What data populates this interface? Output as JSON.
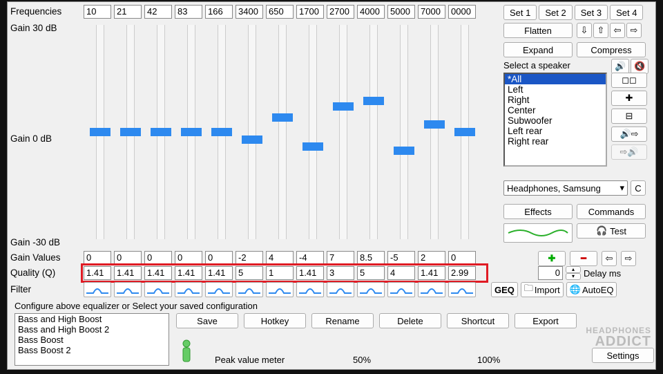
{
  "labels": {
    "frequencies": "Frequencies",
    "gain30": "Gain 30 dB",
    "gain0": "Gain 0 dB",
    "gainm30": "Gain -30 dB",
    "gainvalues": "Gain Values",
    "quality": "Quality (Q)",
    "filter": "Filter",
    "selectspeaker": "Select a speaker",
    "configprompt": "Configure above equalizer or Select your saved configuration",
    "peakmeter": "Peak value meter",
    "p50": "50%",
    "p100": "100%",
    "delay": "Delay ms",
    "delayval": "0",
    "geq": "GEQ",
    "import": "Import",
    "autoeq": "AutoEQ"
  },
  "bands": [
    {
      "freq": "10",
      "gain": "0",
      "q": "1.41",
      "pos": 0.5
    },
    {
      "freq": "21",
      "gain": "0",
      "q": "1.41",
      "pos": 0.5
    },
    {
      "freq": "42",
      "gain": "0",
      "q": "1.41",
      "pos": 0.5
    },
    {
      "freq": "83",
      "gain": "0",
      "q": "1.41",
      "pos": 0.5
    },
    {
      "freq": "166",
      "gain": "0",
      "q": "1.41",
      "pos": 0.5
    },
    {
      "freq": "3400",
      "gain": "-2",
      "q": "5",
      "pos": 0.533
    },
    {
      "freq": "650",
      "gain": "4",
      "q": "1",
      "pos": 0.433
    },
    {
      "freq": "1700",
      "gain": "-4",
      "q": "1.41",
      "pos": 0.567
    },
    {
      "freq": "2700",
      "gain": "7",
      "q": "3",
      "pos": 0.383
    },
    {
      "freq": "4000",
      "gain": "8.5",
      "q": "5",
      "pos": 0.358
    },
    {
      "freq": "5000",
      "gain": "-5",
      "q": "4",
      "pos": 0.583
    },
    {
      "freq": "7000",
      "gain": "2",
      "q": "1.41",
      "pos": 0.467
    },
    {
      "freq": "0000",
      "gain": "0",
      "q": "2.99",
      "pos": 0.5
    }
  ],
  "sets": {
    "s1": "Set 1",
    "s2": "Set 2",
    "s3": "Set 3",
    "s4": "Set 4"
  },
  "buttons": {
    "flatten": "Flatten",
    "expand": "Expand",
    "compress": "Compress",
    "effects": "Effects",
    "commands": "Commands",
    "test": "Test",
    "save": "Save",
    "hotkey": "Hotkey",
    "rename": "Rename",
    "delete": "Delete",
    "shortcut": "Shortcut",
    "export": "Export",
    "settings": "Settings",
    "c": "C"
  },
  "speakers": [
    "*All",
    "Left",
    "Right",
    "Center",
    "Subwoofer",
    "Left rear",
    "Right rear"
  ],
  "speakerSelectedIndex": 0,
  "preset": "Headphones, Samsung",
  "configs": [
    "Bass and High Boost",
    "Bass and High Boost 2",
    "Bass Boost",
    "Bass Boost 2"
  ],
  "watermark": "HEADPHONES ADDICT"
}
